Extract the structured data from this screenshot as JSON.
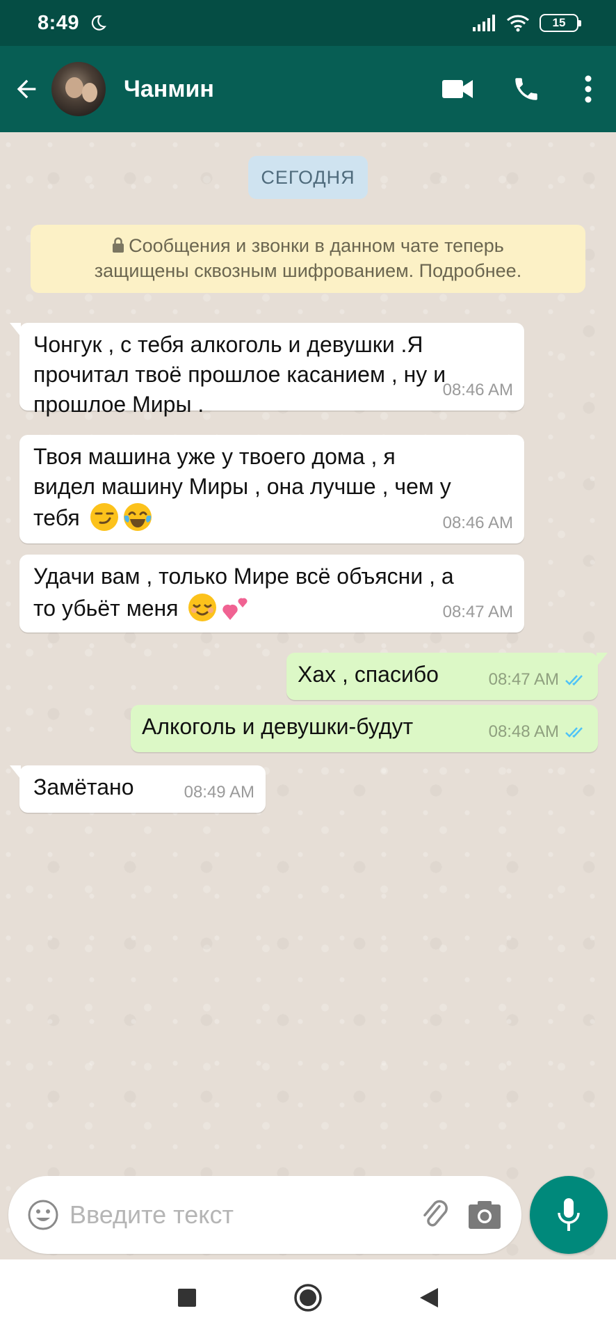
{
  "status_bar": {
    "time": "8:49",
    "battery": "15",
    "icons": [
      "moon-icon",
      "signal-icon",
      "wifi-icon",
      "battery-icon"
    ]
  },
  "header": {
    "contact_name": "Чанмин",
    "icons": [
      "back-arrow-icon",
      "video-call-icon",
      "phone-icon",
      "more-vert-icon"
    ]
  },
  "chat": {
    "date_label": "СЕГОДНЯ",
    "encryption_line1": "Сообщения и звонки в данном чате теперь",
    "encryption_line2": "защищены сквозным шифрованием. Подробнее.",
    "messages": [
      {
        "direction": "in",
        "lines": [
          "Чонгук , с тебя алкоголь и девушки .Я",
          "прочитал твоё прошлое касанием , ну и",
          "прошлое Миры ."
        ],
        "time": "08:46 AM"
      },
      {
        "direction": "in",
        "lines": [
          "Твоя машина уже у твоего дома , я",
          "видел машину Миры , она лучше , чем у",
          "тебя"
        ],
        "emojis": [
          "smirk-emoji",
          "tears-of-joy-emoji"
        ],
        "time": "08:46 AM"
      },
      {
        "direction": "in",
        "lines": [
          "Удачи вам , только Мире всё объясни , а",
          "то убьёт меня"
        ],
        "emojis": [
          "relieved-emoji",
          "two-hearts-emoji"
        ],
        "time": "08:47 AM"
      },
      {
        "direction": "out",
        "lines": [
          "Хах , спасибо"
        ],
        "time": "08:47 AM",
        "status": "read"
      },
      {
        "direction": "out",
        "lines": [
          "Алкоголь и девушки-будут"
        ],
        "time": "08:48 AM",
        "status": "read"
      },
      {
        "direction": "in",
        "lines": [
          "Замётано"
        ],
        "time": "08:49 AM"
      }
    ]
  },
  "composer": {
    "placeholder": "Введите текст",
    "icons": [
      "emoji-icon",
      "attach-icon",
      "camera-icon",
      "mic-icon"
    ]
  },
  "navbar": {
    "icons": [
      "recents-icon",
      "home-icon",
      "back-icon"
    ]
  },
  "colors": {
    "header": "#075e54",
    "status_bar": "#054d44",
    "incoming": "#ffffff",
    "outgoing": "#dcf8c6",
    "accent": "#00897b",
    "read_ticks": "#4fc3f7"
  }
}
